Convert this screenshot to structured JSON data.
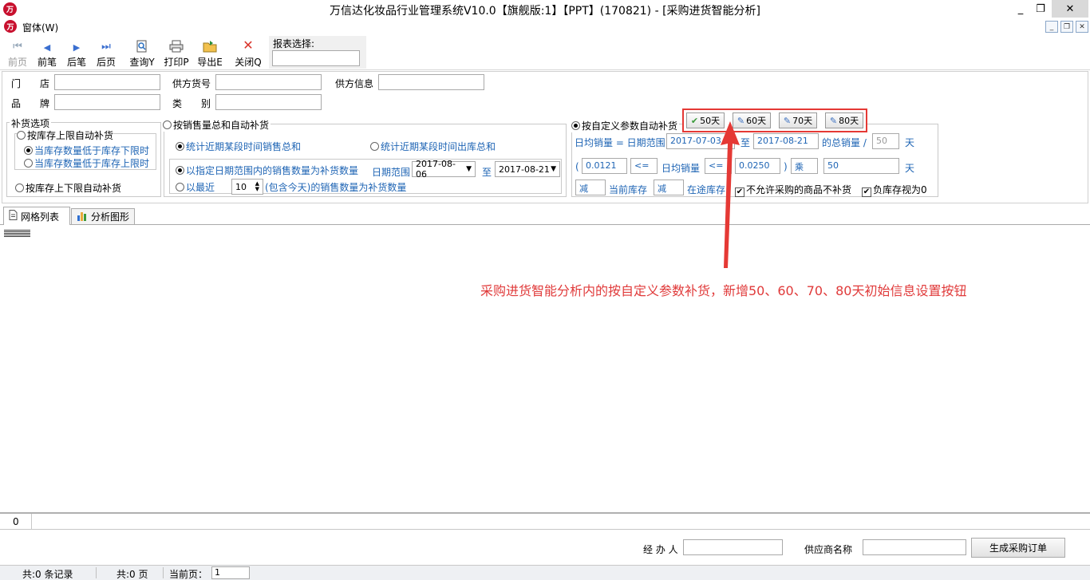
{
  "app": {
    "title": "万信达化妆品行业管理系统V10.0【旗舰版:1】【PPT】(170821) - [采购进货智能分析]",
    "logo_text": "万",
    "window_controls": [
      "_",
      "❐",
      "✕"
    ]
  },
  "menu": {
    "window_menu": "窗体(W)"
  },
  "toolbar": {
    "items": [
      {
        "label": "前页",
        "icon": "first-page-icon",
        "glyph": "◀",
        "enabled": false
      },
      {
        "label": "前笔",
        "icon": "prev-record-icon",
        "glyph": "◀",
        "enabled": true
      },
      {
        "label": "后笔",
        "icon": "next-record-icon",
        "glyph": "▶",
        "enabled": true
      },
      {
        "label": "后页",
        "icon": "last-page-icon",
        "glyph": "▶",
        "enabled": true
      },
      {
        "label": "查询Y",
        "icon": "query-icon",
        "glyph": "🔍",
        "enabled": true
      },
      {
        "label": "打印P",
        "icon": "print-icon",
        "glyph": "🖶",
        "enabled": true
      },
      {
        "label": "导出E",
        "icon": "export-icon",
        "glyph": "📂",
        "enabled": true
      },
      {
        "label": "关闭Q",
        "icon": "close-icon",
        "glyph": "✕",
        "enabled": true
      }
    ],
    "report_select_label": "报表选择:",
    "report_select_value": ""
  },
  "filters": {
    "store_label": "门　　店",
    "store_value": "",
    "supplier_code_label": "供方货号",
    "supplier_code_value": "",
    "supplier_info_label": "供方信息",
    "supplier_info_value": "",
    "brand_label": "品　　牌",
    "brand_value": "",
    "category_label": "类　　别",
    "category_value": ""
  },
  "replenish": {
    "group_title": "补货选项",
    "upper_auto": "按库存上限自动补货",
    "below_lower": "当库存数量低于库存下限时",
    "below_upper": "当库存数量低于库存上限时",
    "upper_lower_auto": "按库存上下限自动补货"
  },
  "sales": {
    "title": "按销售量总和自动补货",
    "recent_sales": "统计近期某段时间销售总和",
    "recent_outbound": "统计近期某段时间出库总和",
    "specified_range": "以指定日期范围内的销售数量为补货数量",
    "date_range_label": "日期范围",
    "date_from": "2017-08-06",
    "to_label": "至",
    "date_to": "2017-08-21",
    "recent_label": "以最近",
    "recent_days": "10",
    "recent_suffix": "(包含今天)的销售数量为补货数量"
  },
  "custom": {
    "title": "按自定义参数自动补货",
    "day_buttons": [
      {
        "label": "50天",
        "icon": "check-icon",
        "glyph": "✔"
      },
      {
        "label": "60天",
        "icon": "edit-icon",
        "glyph": "✎"
      },
      {
        "label": "70天",
        "icon": "edit-icon",
        "glyph": "✎"
      },
      {
        "label": "80天",
        "icon": "edit-icon",
        "glyph": "✎"
      }
    ],
    "avg_sales_label": "日均销量 = 日期范围",
    "range_from": "2017-07-03",
    "to_label": "至",
    "range_to": "2017-08-21",
    "total_sales_label": "的总销量 /",
    "days_value": "50",
    "days_unit": "天",
    "paren_open": "(",
    "min_value": "0.0121",
    "op1": "<=",
    "avg_label": "日均销量",
    "op2": "<=",
    "max_value": "0.0250",
    "paren_close": ")",
    "multiply": "乘",
    "multiply_days": "50",
    "multiply_unit": "天",
    "minus1": "减",
    "current_stock": "当前库存",
    "minus2": "减",
    "in_transit": "在途库存",
    "no_purchase_label": "不允许采购的商品不补货",
    "negative_zero_label": "负库存视为0"
  },
  "tabs": [
    {
      "label": "网格列表",
      "icon": "document-icon"
    },
    {
      "label": "分析图形",
      "icon": "bar-chart-icon"
    }
  ],
  "annotation": "采购进货智能分析内的按自定义参数补货，新增50、60、70、80天初始信息设置按钮",
  "summary": {
    "total": "0"
  },
  "footer": {
    "handler_label": "经 办 人",
    "handler_value": "",
    "supplier_label": "供应商名称",
    "supplier_value": "",
    "generate_button": "生成采购订单"
  },
  "status": {
    "records": "共:0 条记录",
    "pages": "共:0 页",
    "current_page_label": "当前页：",
    "current_page": "1"
  },
  "colors": {
    "accent_red": "#e53935",
    "link_blue": "#1e64b4",
    "logo_red": "#c8102e"
  }
}
